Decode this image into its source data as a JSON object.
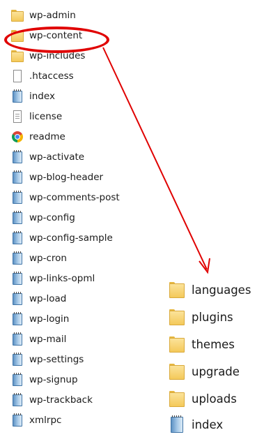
{
  "main_list": {
    "items": [
      {
        "label": "wp-admin",
        "icon": "folder-icon"
      },
      {
        "label": "wp-content",
        "icon": "folder-icon"
      },
      {
        "label": "wp-includes",
        "icon": "folder-icon"
      },
      {
        "label": ".htaccess",
        "icon": "blank-file-icon"
      },
      {
        "label": "index",
        "icon": "php-file-icon"
      },
      {
        "label": "license",
        "icon": "text-file-icon"
      },
      {
        "label": "readme",
        "icon": "chrome-icon"
      },
      {
        "label": "wp-activate",
        "icon": "php-file-icon"
      },
      {
        "label": "wp-blog-header",
        "icon": "php-file-icon"
      },
      {
        "label": "wp-comments-post",
        "icon": "php-file-icon"
      },
      {
        "label": "wp-config",
        "icon": "php-file-icon"
      },
      {
        "label": "wp-config-sample",
        "icon": "php-file-icon"
      },
      {
        "label": "wp-cron",
        "icon": "php-file-icon"
      },
      {
        "label": "wp-links-opml",
        "icon": "php-file-icon"
      },
      {
        "label": "wp-load",
        "icon": "php-file-icon"
      },
      {
        "label": "wp-login",
        "icon": "php-file-icon"
      },
      {
        "label": "wp-mail",
        "icon": "php-file-icon"
      },
      {
        "label": "wp-settings",
        "icon": "php-file-icon"
      },
      {
        "label": "wp-signup",
        "icon": "php-file-icon"
      },
      {
        "label": "wp-trackback",
        "icon": "php-file-icon"
      },
      {
        "label": "xmlrpc",
        "icon": "php-file-icon"
      }
    ]
  },
  "wp_content_list": {
    "items": [
      {
        "label": "languages",
        "icon": "folder-icon"
      },
      {
        "label": "plugins",
        "icon": "folder-icon"
      },
      {
        "label": "themes",
        "icon": "folder-icon"
      },
      {
        "label": "upgrade",
        "icon": "folder-icon"
      },
      {
        "label": "uploads",
        "icon": "folder-icon"
      },
      {
        "label": "index",
        "icon": "php-file-icon"
      }
    ]
  },
  "annotation": {
    "highlighted_item": "wp-content",
    "color": "#e00000"
  }
}
